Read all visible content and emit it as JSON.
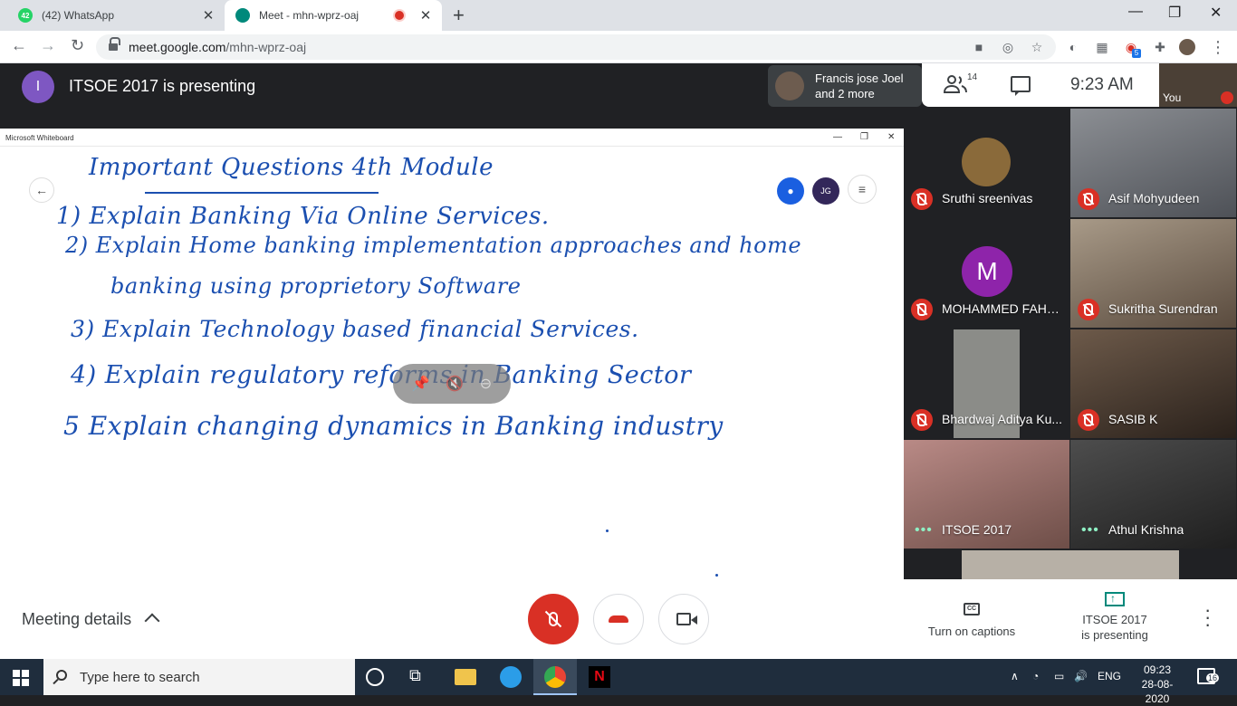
{
  "browser": {
    "tabs": [
      {
        "badge": "42",
        "title": "(42) WhatsApp"
      },
      {
        "title": "Meet - mhn-wprz-oaj"
      }
    ],
    "url_domain": "meet.google.com",
    "url_path": "/mhn-wprz-oaj",
    "ext_badge": "5"
  },
  "meet": {
    "presenter_initial": "I",
    "presenting_title": "ITSOE 2017 is presenting",
    "speaker_line1": "Francis jose Joel",
    "speaker_line2": "and 2 more",
    "participant_count": "14",
    "time": "9:23  AM",
    "self_label": "You"
  },
  "whiteboard": {
    "window_title": "Microsoft Whiteboard",
    "user_initials": "JG",
    "lines": [
      "Important Questions  4th Module",
      "1) Explain Banking Via  Online Services.",
      "2) Explain Home banking implementation approaches and home",
      "banking using proprietory Software",
      "3) Explain Technology based financial Services.",
      "4) Explain regulatory reforms in Banking Sector",
      "5  Explain changing dynamics in Banking industry"
    ]
  },
  "participants": [
    {
      "name": "Sruthi sreenivas",
      "muted": true
    },
    {
      "name": "Asif Mohyudeen",
      "muted": true
    },
    {
      "name": "MOHAMMED FAHAD...",
      "muted": true,
      "initial": "M"
    },
    {
      "name": "Sukritha Surendran",
      "muted": true
    },
    {
      "name": "Bhardwaj Aditya Ku...",
      "muted": true
    },
    {
      "name": "SASIB K",
      "muted": true
    },
    {
      "name": "ITSOE 2017",
      "muted": false
    },
    {
      "name": "Athul Krishna",
      "muted": false
    }
  ],
  "controls": {
    "meeting_details": "Meeting details",
    "captions": "Turn on captions",
    "captions_icon": "CC",
    "presenting_line1": "ITSOE 2017",
    "presenting_line2": "is presenting"
  },
  "taskbar": {
    "search_placeholder": "Type here to search",
    "language": "ENG",
    "time": "09:23",
    "date": "28-08-2020",
    "notification_count": "16"
  },
  "colors": {
    "meet_dark": "#202124",
    "mute_red": "#d93025",
    "ink_blue": "#1b4fb0",
    "presenter_purple": "#7e57c2",
    "fahad_purple": "#8e24aa"
  }
}
